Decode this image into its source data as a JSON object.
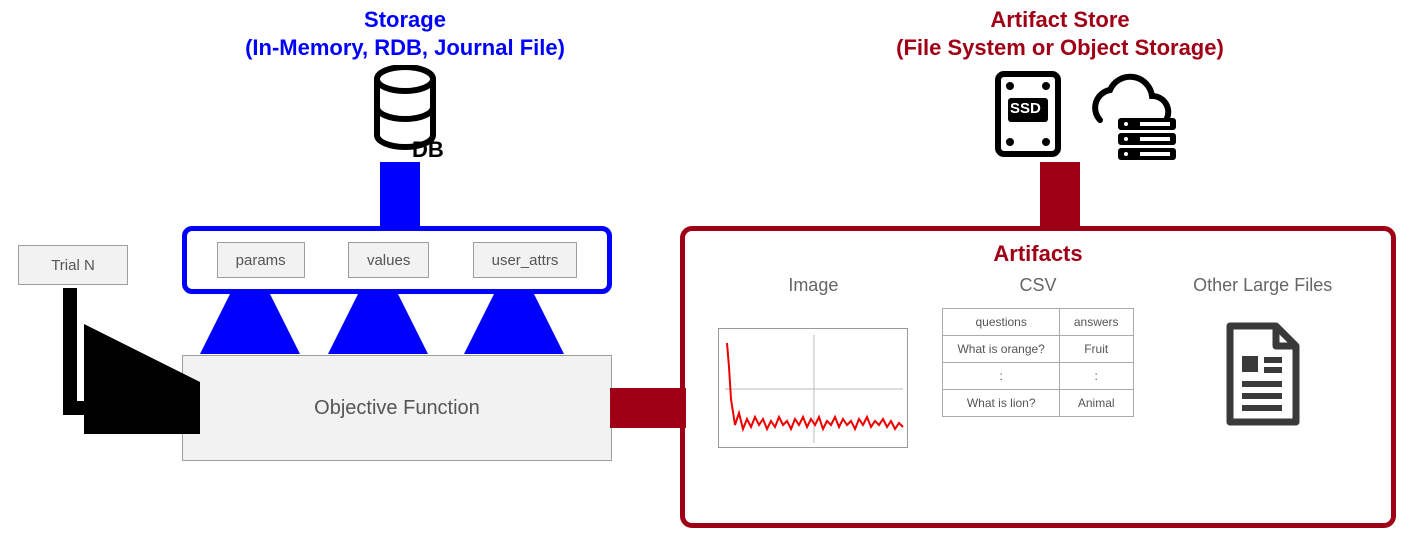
{
  "storage": {
    "title_line1": "Storage",
    "title_line2": "(In-Memory, RDB, Journal File)",
    "chips": {
      "params": "params",
      "values": "values",
      "user_attrs": "user_attrs"
    }
  },
  "artifact_store": {
    "title_line1": "Artifact Store",
    "title_line2": "(File System or Object Storage)"
  },
  "trial_label": "Trial N",
  "objective_label": "Objective Function",
  "artifacts": {
    "title": "Artifacts",
    "image_label": "Image",
    "csv_label": "CSV",
    "other_label": "Other Large Files",
    "csv_header": {
      "q": "questions",
      "a": "answers"
    },
    "csv_rows": [
      {
        "q": "What is orange?",
        "a": "Fruit"
      },
      {
        "q": ":",
        "a": ":"
      },
      {
        "q": "What is lion?",
        "a": "Animal"
      }
    ]
  },
  "icons": {
    "ssd_label": "SSD",
    "db_label": "DB"
  }
}
